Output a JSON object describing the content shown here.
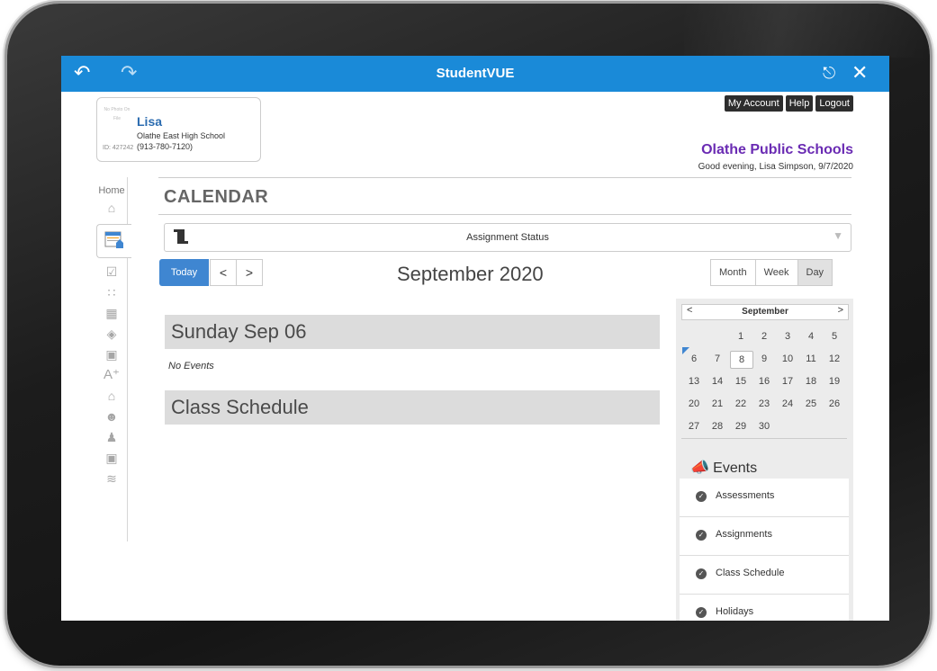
{
  "app": {
    "title": "StudentVUE",
    "back_icon": "back-arrow-icon",
    "forward_icon": "forward-arrow-icon",
    "share_icon": "share-icon",
    "close_icon": "close-icon",
    "accent": "#1a8ad8"
  },
  "profile": {
    "photo_text": "No Photo On File",
    "name": "Lisa",
    "school": "Olathe East High School",
    "phone": "(913-780-7120)",
    "id": "ID: 427242"
  },
  "account": {
    "my_account": "My Account",
    "help": "Help",
    "logout": "Logout"
  },
  "district": {
    "name": "Olathe Public Schools",
    "greeting": "Good evening, Lisa Simpson, 9/7/2020",
    "color": "#6a2bb3"
  },
  "sidebar": {
    "home_label": "Home"
  },
  "page": {
    "title": "CALENDAR",
    "status_label": "Assignment Status"
  },
  "toolbar": {
    "today": "Today",
    "prev": "<",
    "next": ">",
    "month_title": "September 2020",
    "views": [
      "Month",
      "Week",
      "Day"
    ],
    "active_view": "Day"
  },
  "day": {
    "heading": "Sunday Sep 06",
    "no_events": "No Events",
    "schedule_heading": "Class Schedule"
  },
  "mini_calendar": {
    "month": "September",
    "prev": "<",
    "next": ">",
    "weeks": [
      [
        "",
        "",
        "1",
        "2",
        "3",
        "4",
        "5"
      ],
      [
        "6",
        "7",
        "8",
        "9",
        "10",
        "11",
        "12"
      ],
      [
        "13",
        "14",
        "15",
        "16",
        "17",
        "18",
        "19"
      ],
      [
        "20",
        "21",
        "22",
        "23",
        "24",
        "25",
        "26"
      ],
      [
        "27",
        "28",
        "29",
        "30",
        "",
        "",
        ""
      ]
    ],
    "today": "8",
    "flagged": "6"
  },
  "events": {
    "heading": "Events",
    "items": [
      {
        "label": "Assessments",
        "checked": true
      },
      {
        "label": "Assignments",
        "checked": true
      },
      {
        "label": "Class Schedule",
        "checked": true
      },
      {
        "label": "Holidays",
        "checked": true
      }
    ]
  }
}
